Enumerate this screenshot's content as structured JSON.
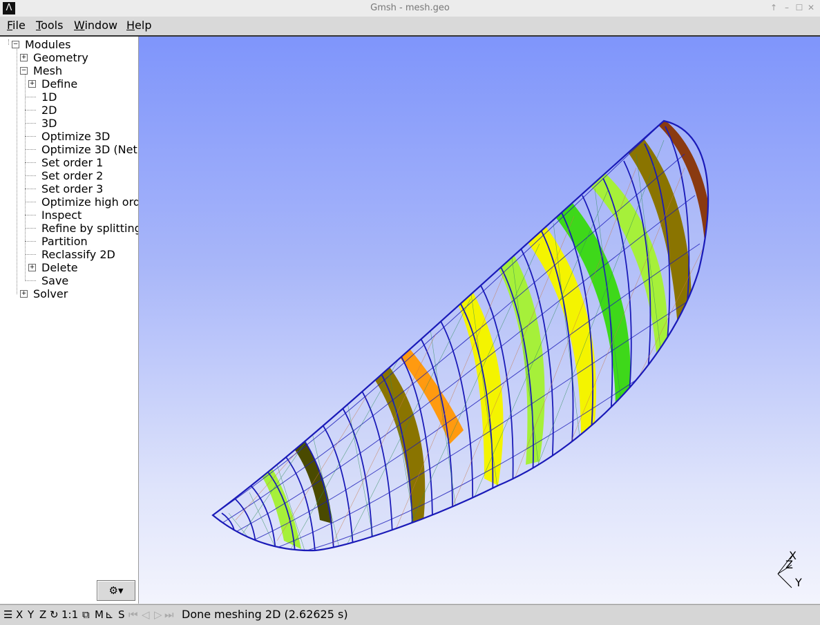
{
  "window": {
    "title": "Gmsh - mesh.geo",
    "icon": "gmsh-logo-icon",
    "buttons": [
      "↑",
      "–",
      "☐",
      "✕"
    ]
  },
  "menu": [
    {
      "label": "File",
      "underline": "F",
      "rest": "ile"
    },
    {
      "label": "Tools",
      "underline": "T",
      "rest": "ools"
    },
    {
      "label": "Window",
      "underline": "W",
      "rest": "indow"
    },
    {
      "label": "Help",
      "underline": "H",
      "rest": "elp"
    }
  ],
  "tree": {
    "root": "Modules",
    "geometry": "Geometry",
    "mesh": "Mesh",
    "mesh_items": [
      "Define",
      "1D",
      "2D",
      "3D",
      "Optimize 3D",
      "Optimize 3D (Net",
      "Set order 1",
      "Set order 2",
      "Set order 3",
      "Optimize high ord",
      "Inspect",
      "Refine by splitting",
      "Partition",
      "Reclassify 2D",
      "Delete",
      "Save"
    ],
    "solver": "Solver"
  },
  "gear_button": "⚙▾",
  "axes": {
    "x": "X",
    "z": "Z",
    "y": "Y"
  },
  "statusbar": {
    "menu_icon": "☰",
    "x": "X",
    "y": "Y",
    "z": "Z",
    "rotate_icon": "↻",
    "scale": "1:1",
    "cube_icon": "⧉",
    "m": "M",
    "measure_icon": "⊾",
    "s": "S",
    "first": "⏮",
    "prev": "◁",
    "play": "▷",
    "last": "⏭",
    "message": "Done meshing 2D (2.62625 s)"
  },
  "colors": {
    "mesh_blue": "#1a1ab8",
    "surface_yellow": "#f4f400",
    "surface_green": "#3ed81a",
    "surface_lime": "#a6f03a",
    "surface_olive": "#8a7400",
    "surface_orange": "#ff9a10",
    "surface_dark": "#4a4a00"
  }
}
